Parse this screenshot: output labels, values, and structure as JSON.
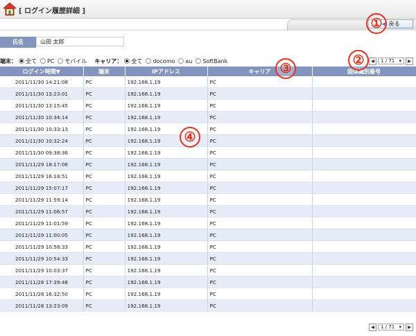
{
  "header": {
    "title": "[ ログイン履歴詳細 ]",
    "back_label": "戻る"
  },
  "user": {
    "name_label": "氏名",
    "name_value": "山田 太郎"
  },
  "filters": {
    "device_label": "端末：",
    "device_options": [
      "全て",
      "PC",
      "モバイル"
    ],
    "device_selected": 0,
    "carrier_label": "キャリア：",
    "carrier_options": [
      "全て",
      "docomo",
      "au",
      "SoftBank"
    ],
    "carrier_selected": 0
  },
  "pager": {
    "value": "1 / 71"
  },
  "annotations": [
    "①",
    "②",
    "③",
    "④"
  ],
  "table": {
    "columns": [
      "ログイン時間▼",
      "端末",
      "IPアドレス",
      "キャリア",
      "固体識別番号"
    ],
    "rows": [
      [
        "2011/11/30 14:21:08",
        "PC",
        "192.168.1.19",
        "PC",
        ""
      ],
      [
        "2011/11/30 13:23:01",
        "PC",
        "192.168.1.19",
        "PC",
        ""
      ],
      [
        "2011/11/30 13:15:45",
        "PC",
        "192.168.1.19",
        "PC",
        ""
      ],
      [
        "2011/11/30 10:34:14",
        "PC",
        "192.168.1.19",
        "PC",
        ""
      ],
      [
        "2011/11/30 10:33:13",
        "PC",
        "192.168.1.19",
        "PC",
        ""
      ],
      [
        "2011/11/30 10:32:24",
        "PC",
        "192.168.1.19",
        "PC",
        ""
      ],
      [
        "2011/11/30 09:38:36",
        "PC",
        "192.168.1.19",
        "PC",
        ""
      ],
      [
        "2011/11/29 18:17:06",
        "PC",
        "192.168.1.19",
        "PC",
        ""
      ],
      [
        "2011/11/29 16:18:51",
        "PC",
        "192.168.1.19",
        "PC",
        ""
      ],
      [
        "2011/11/29 15:07:17",
        "PC",
        "192.168.1.19",
        "PC",
        ""
      ],
      [
        "2011/11/29 11:59:14",
        "PC",
        "192.168.1.19",
        "PC",
        ""
      ],
      [
        "2011/11/29 11:06:57",
        "PC",
        "192.168.1.19",
        "PC",
        ""
      ],
      [
        "2011/11/29 11:01:59",
        "PC",
        "192.168.1.19",
        "PC",
        ""
      ],
      [
        "2011/11/29 11:00:05",
        "PC",
        "192.168.1.19",
        "PC",
        ""
      ],
      [
        "2011/11/29 10:58:33",
        "PC",
        "192.168.1.19",
        "PC",
        ""
      ],
      [
        "2011/11/29 10:54:33",
        "PC",
        "192.168.1.19",
        "PC",
        ""
      ],
      [
        "2011/11/29 10:03:37",
        "PC",
        "192.168.1.19",
        "PC",
        ""
      ],
      [
        "2011/11/28 17:39:48",
        "PC",
        "192.168.1.19",
        "PC",
        ""
      ],
      [
        "2011/11/28 16:32:50",
        "PC",
        "192.168.1.19",
        "PC",
        ""
      ],
      [
        "2011/11/28 13:23:09",
        "PC",
        "192.168.1.19",
        "PC",
        ""
      ]
    ]
  },
  "colors": {
    "header_bg": "#8395be",
    "row_alt": "#e6ecf8",
    "annotation": "#e0331c"
  }
}
